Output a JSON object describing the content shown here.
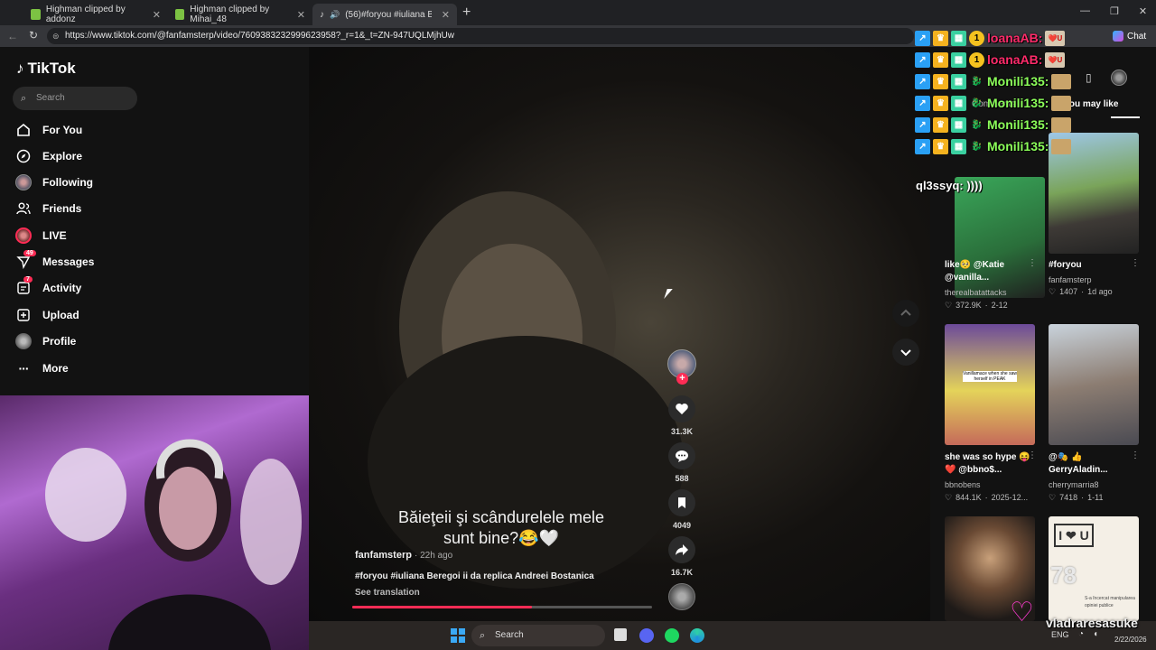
{
  "browser": {
    "tabs": [
      {
        "title": "Highman clipped by addonz"
      },
      {
        "title": "Highman clipped by Mihai_48"
      },
      {
        "title": "(56)#foryou #iuliana Beregoi"
      }
    ],
    "new_tab": "+",
    "url": "https://www.tiktok.com/@fanfamsterp/video/7609383232999623958?_r=1&_t=ZN-947UQLMjhUw",
    "chat_label": "Chat"
  },
  "tiktok": {
    "logo_text": "TikTok",
    "search_placeholder": "Search",
    "nav": [
      {
        "label": "For You",
        "icon": "home-icon"
      },
      {
        "label": "Explore",
        "icon": "compass-icon"
      },
      {
        "label": "Following",
        "icon": "avatar-icon"
      },
      {
        "label": "Friends",
        "icon": "friends-icon"
      },
      {
        "label": "LIVE",
        "icon": "live-icon"
      },
      {
        "label": "Messages",
        "icon": "paper-plane-icon",
        "badge": "49"
      },
      {
        "label": "Activity",
        "icon": "inbox-icon",
        "badge": "7"
      },
      {
        "label": "Upload",
        "icon": "plus-square-icon"
      },
      {
        "label": "Profile",
        "icon": "avatar-icon"
      },
      {
        "label": "More",
        "icon": "more-icon"
      }
    ],
    "video": {
      "caption_line1": "Băieţeii şi scândurelele mele",
      "caption_line2": "sunt bine?😂🤍",
      "author": "fanfamsterp",
      "time": "· 22h ago",
      "description": "#foryou #iuliana Beregoi ii da replica Andreei Bostanica",
      "see_translation": "See translation",
      "progress_fraction": 0.6
    },
    "actions": [
      {
        "name": "like",
        "count": "31.3K"
      },
      {
        "name": "comment",
        "count": "588"
      },
      {
        "name": "save",
        "count": "4049"
      },
      {
        "name": "share",
        "count": "16.7K"
      }
    ],
    "right_panel": {
      "heading": "You may like",
      "comments_label": "Comments",
      "cards": [
        {
          "title": "like🥺 @Katie @vanilla...",
          "author": "therealbatattacks",
          "likes": "372.9K",
          "date": "2-12"
        },
        {
          "title": "#foryou",
          "author": "fanfamsterp",
          "likes": "1407",
          "date": "1d ago"
        },
        {
          "title": "she was so hype 😝❤️ @bbno$...",
          "author": "bbnobens",
          "likes": "844.1K",
          "date": "2025-12..."
        },
        {
          "title": "@🎭 👍GerryAladin...",
          "author": "cherrymarria8",
          "likes": "7418",
          "date": "1-11"
        }
      ],
      "thumb_texts": {
        "vanilla_caption": "Vanillamace when she saw herself in PEAK",
        "card6_text": "I ❤ U",
        "card6_number": "78",
        "card6_lines": [
          "S-a încercat manipularea",
          "opiniei publice"
        ]
      }
    }
  },
  "stream_chat": {
    "lines": [
      {
        "user": "loanaAB:",
        "color": "#ff2b6a",
        "trail": "❤️U"
      },
      {
        "user": "loanaAB:",
        "color": "#ff2b6a",
        "trail": "❤️U"
      },
      {
        "user": "Monili135:",
        "color": "#8cff5a",
        "trail": ""
      },
      {
        "user": "Monili135:",
        "color": "#8cff5a",
        "trail": ""
      },
      {
        "user": "Monili135:",
        "color": "#8cff5a",
        "trail": ""
      },
      {
        "user": "Monili135:",
        "color": "#8cff5a",
        "trail": ""
      }
    ],
    "partial_line": "ql3ssyq: ))))",
    "chip_badge": "1"
  },
  "overlay": {
    "streamer_name": "vladraresasuke",
    "heart": "♡"
  },
  "taskbar": {
    "search_label": "Search",
    "lang": "ENG",
    "date": "2/22/2026"
  },
  "colors": {
    "tiktok_red": "#fe2c55",
    "chat_pink": "#ff2b6a",
    "chat_green": "#8cff5a",
    "heart_magenta": "#ff3bd4"
  }
}
